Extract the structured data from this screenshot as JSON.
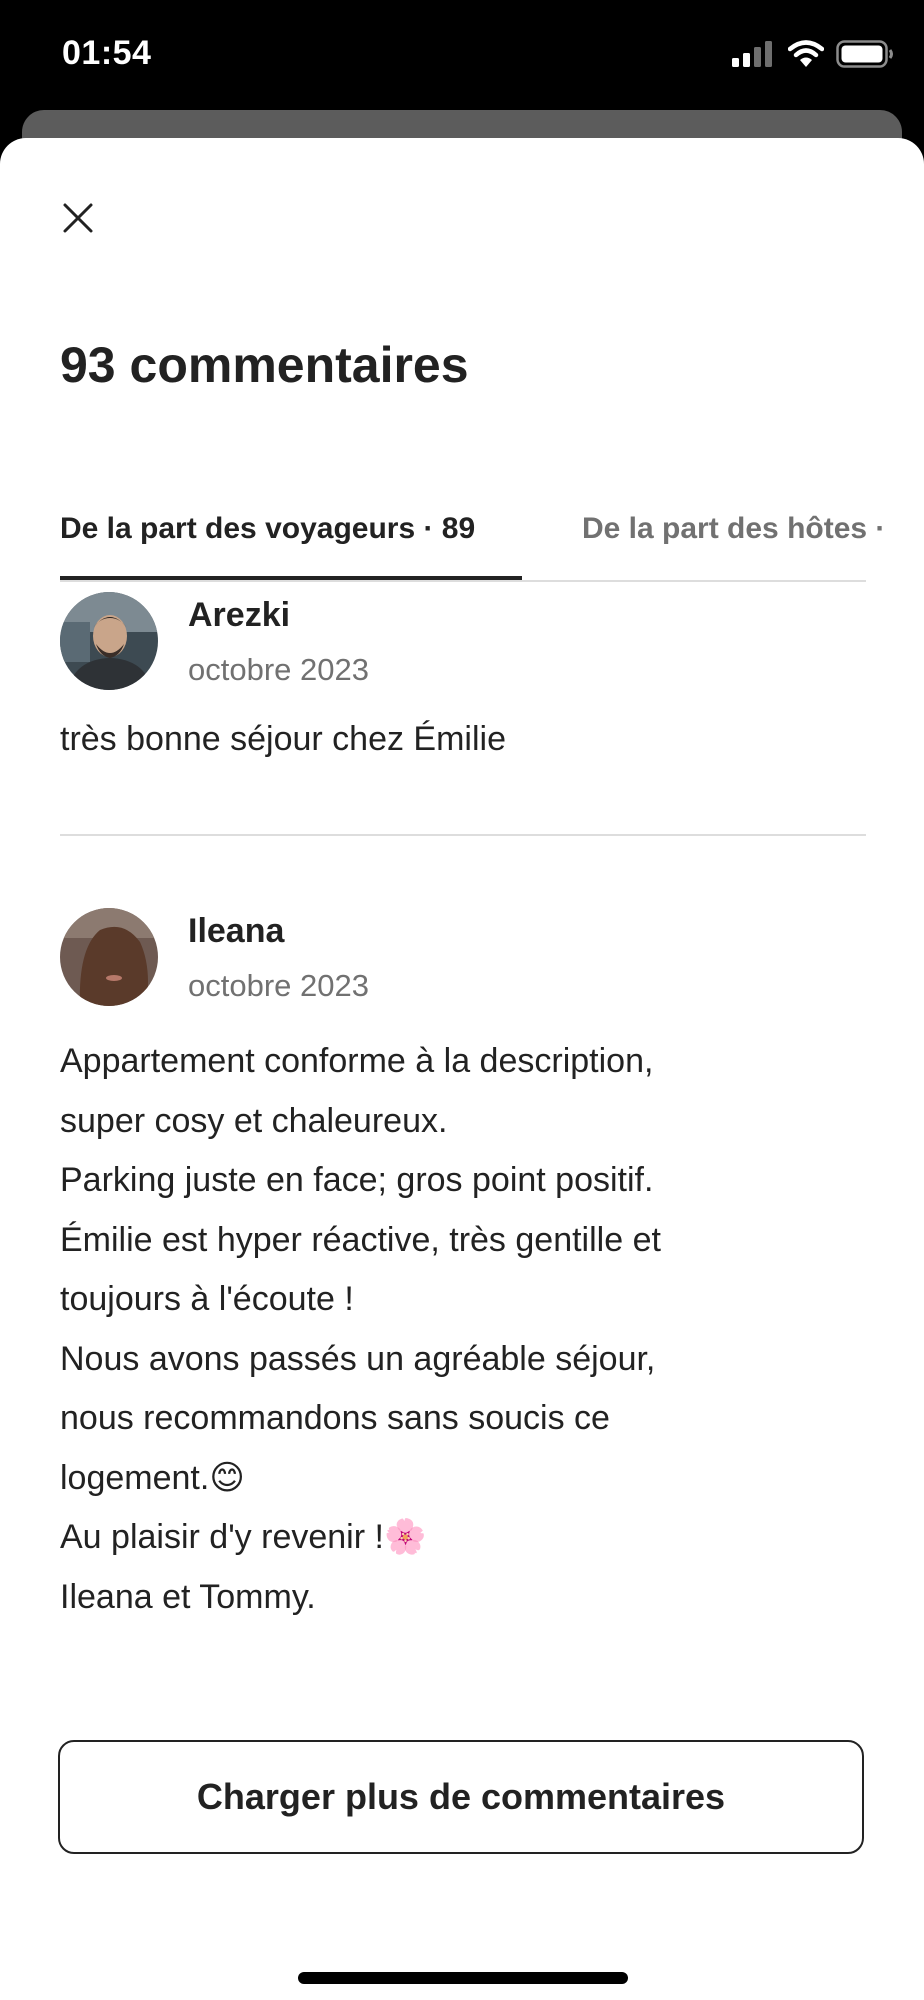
{
  "status_bar": {
    "time": "01:54",
    "icons": [
      "cellular-signal-icon",
      "wifi-icon",
      "battery-icon"
    ]
  },
  "modal": {
    "title": "93 commentaires",
    "close_icon": "close-icon"
  },
  "tabs": [
    {
      "label": "De la part des voyageurs · 89",
      "active": true
    },
    {
      "label": "De la part des hôtes ·",
      "active": false
    }
  ],
  "reviews": [
    {
      "name": "Arezki",
      "date": "octobre 2023",
      "text": "très bonne séjour chez Émilie"
    },
    {
      "name": "Ileana",
      "date": "octobre 2023",
      "text": "Appartement conforme à la description,\nsuper cosy et chaleureux.\nParking juste en face; gros point positif.\nÉmilie est hyper réactive, très gentille et\ntoujours à l'écoute !\nNous avons passés un agréable séjour,\nnous recommandons sans soucis ce\nlogement.😊\nAu plaisir d'y revenir !🌸\nIleana et Tommy."
    }
  ],
  "load_more_label": "Charger plus de commentaires",
  "colors": {
    "text_primary": "#222222",
    "text_secondary": "#717171",
    "divider": "#dddddd",
    "background": "#ffffff"
  }
}
